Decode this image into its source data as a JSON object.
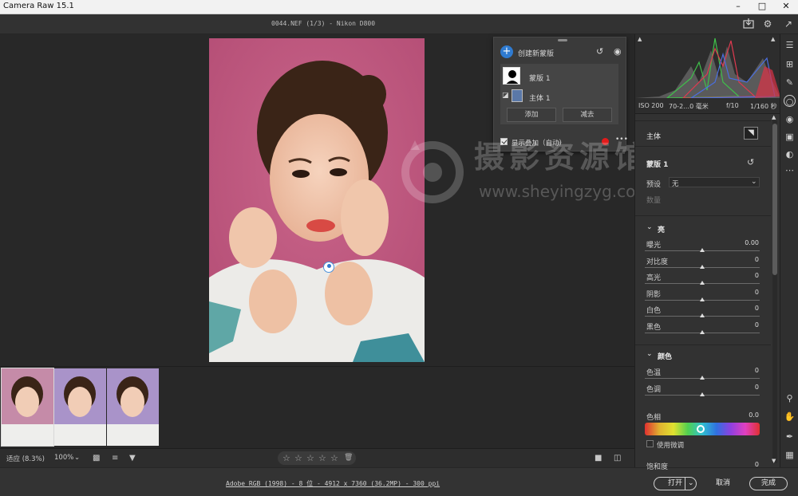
{
  "window": {
    "title": "Camera Raw 15.1"
  },
  "topbar": {
    "filename": "0044.NEF (1/3)  -  Nikon D800"
  },
  "mask_panel": {
    "create_label": "创建新蒙版",
    "mask_item": "蒙版 1",
    "subject_item": "主体 1",
    "add_label": "添加",
    "subtract_label": "减去",
    "overlay_label": "显示叠加（自动）"
  },
  "watermark": {
    "line1": "摄影资源馆",
    "line2": "www.sheyingzyg.com"
  },
  "histogram": {
    "meta": [
      "ISO 200",
      "70-2…0 毫米",
      "f/10",
      "1/160 秒"
    ]
  },
  "right_panel": {
    "subject_label": "主体",
    "mask_name": "蒙版 1",
    "preset_label": "预设",
    "preset_value": "无",
    "amount_label": "数量",
    "light_section": "亮",
    "light_sliders": [
      {
        "label": "曝光",
        "value": "0.00",
        "pos": 0.5
      },
      {
        "label": "对比度",
        "value": "0",
        "pos": 0.5
      },
      {
        "label": "高光",
        "value": "0",
        "pos": 0.5
      },
      {
        "label": "阴影",
        "value": "0",
        "pos": 0.5
      },
      {
        "label": "白色",
        "value": "0",
        "pos": 0.5
      },
      {
        "label": "黑色",
        "value": "0",
        "pos": 0.5
      }
    ],
    "color_section": "颜色",
    "color_sliders": [
      {
        "label": "色温",
        "value": "0",
        "pos": 0.5
      },
      {
        "label": "色调",
        "value": "0",
        "pos": 0.5
      }
    ],
    "hue_label": "色相",
    "hue_value": "0.0",
    "hue_pos": 0.5,
    "fine_label": "使用微调",
    "saturation_label": "饱和度",
    "saturation_value": "0"
  },
  "bottom_toolbar": {
    "fit_label": "适应 (8.3%)",
    "zoom_label": "100%"
  },
  "status": {
    "info": "Adobe RGB (1998) - 8 位 - 4912 x 7360 (36.2MP) - 300 ppi",
    "open_label": "打开",
    "cancel_label": "取消",
    "done_label": "完成"
  },
  "colors": {
    "accent": "#2f7bd1",
    "photo_bg": "#c0557a",
    "overlay_dot": "#e31b1b"
  },
  "icons": [
    "save-icon",
    "gear-icon",
    "expand-icon",
    "crop-icon",
    "brush-icon",
    "mask-icon",
    "redeye-icon",
    "layers-icon",
    "presets-icon",
    "more-icon",
    "zoom-icon",
    "hand-icon",
    "eyedropper-icon",
    "grid-icon",
    "filter-icon",
    "sort-icon",
    "trash-icon"
  ]
}
